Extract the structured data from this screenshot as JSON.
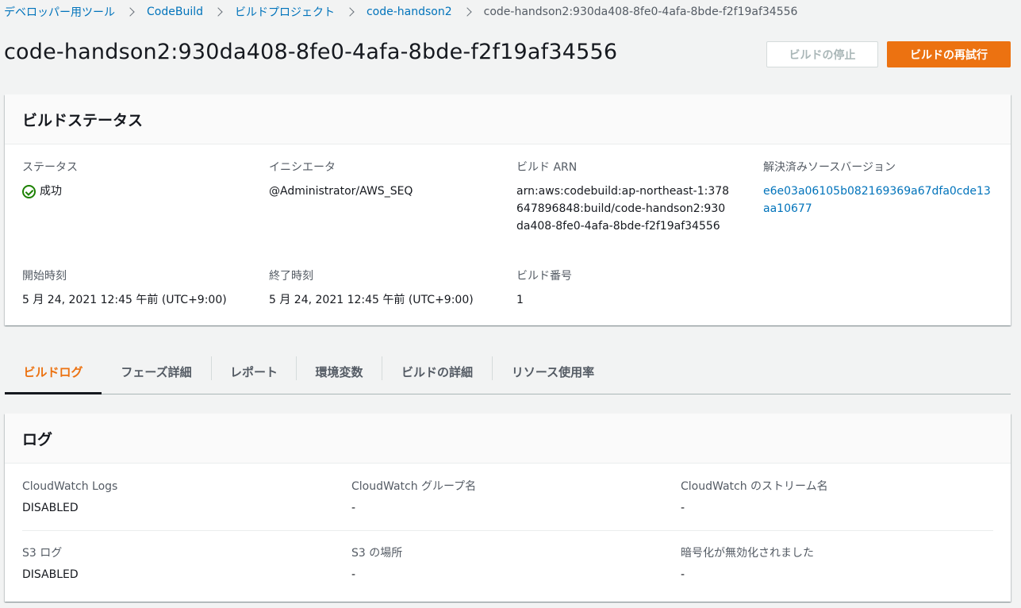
{
  "breadcrumb": {
    "items": [
      "デベロッパー用ツール",
      "CodeBuild",
      "ビルドプロジェクト",
      "code-handson2"
    ],
    "current": "code-handson2:930da408-8fe0-4afa-8bde-f2f19af34556"
  },
  "header": {
    "title": "code-handson2:930da408-8fe0-4afa-8bde-f2f19af34556",
    "stop_label": "ビルドの停止",
    "retry_label": "ビルドの再試行"
  },
  "status_card": {
    "title": "ビルドステータス",
    "status_label": "ステータス",
    "status_value": "成功",
    "initiator_label": "イニシエータ",
    "initiator_value": "@Administrator/AWS_SEQ",
    "arn_label": "ビルド ARN",
    "arn_value": "arn:aws:codebuild:ap-northeast-1:378647896848:build/code-handson2:930da408-8fe0-4afa-8bde-f2f19af34556",
    "source_label": "解決済みソースバージョン",
    "source_value": "e6e03a06105b082169369a67dfa0cde13aa10677",
    "start_label": "開始時刻",
    "start_value": "5 月 24, 2021 12:45 午前 (UTC+9:00)",
    "end_label": "終了時刻",
    "end_value": "5 月 24, 2021 12:45 午前 (UTC+9:00)",
    "number_label": "ビルド番号",
    "number_value": "1"
  },
  "tabs": [
    "ビルドログ",
    "フェーズ詳細",
    "レポート",
    "環境変数",
    "ビルドの詳細",
    "リソース使用率"
  ],
  "log_card": {
    "title": "ログ",
    "cw_logs_label": "CloudWatch Logs",
    "cw_logs_value": "DISABLED",
    "cw_group_label": "CloudWatch グループ名",
    "cw_group_value": "-",
    "cw_stream_label": "CloudWatch のストリーム名",
    "cw_stream_value": "-",
    "s3_label": "S3 ログ",
    "s3_value": "DISABLED",
    "s3_location_label": "S3 の場所",
    "s3_location_value": "-",
    "encryption_label": "暗号化が無効化されました",
    "encryption_value": "-"
  },
  "colors": {
    "accent": "#ec7211",
    "link": "#0073bb",
    "success": "#1d8102"
  }
}
